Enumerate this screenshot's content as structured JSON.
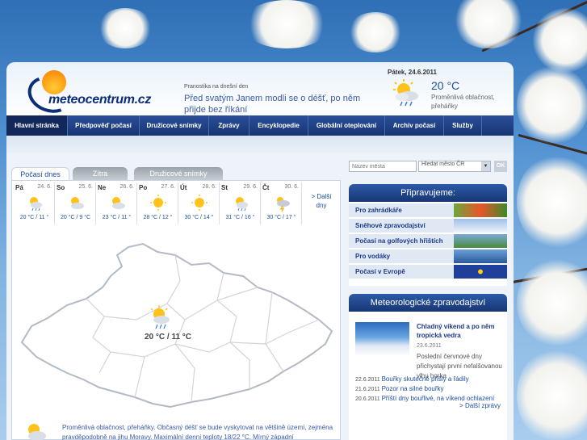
{
  "site": {
    "logo_text": "meteocentrum.cz",
    "forecast_label": "Pranostika na dnešní den",
    "forecast_text": "Před svatým Janem modli se o déšť, po něm přijde bez říkání",
    "today": {
      "date": "Pátek, 24.6.2011",
      "temp": "20 °C",
      "desc": "Proměnlivá oblačnost, přeháňky",
      "icon": "sun-cloud-rain-icon"
    }
  },
  "nav": {
    "items": [
      {
        "label": "Hlavní stránka",
        "active": true
      },
      {
        "label": "Předpověď počasí"
      },
      {
        "label": "Družicové snímky"
      },
      {
        "label": "Zprávy"
      },
      {
        "label": "Encyklopedie"
      },
      {
        "label": "Globální oteplování"
      },
      {
        "label": "Archiv počasí"
      },
      {
        "label": "Služby"
      }
    ]
  },
  "tabs": {
    "today": "Počasí dnes",
    "tomorrow": "Zítra",
    "satellite": "Družicové snímky"
  },
  "days": [
    {
      "name": "Pá",
      "date": "24. 6.",
      "temp": "20 °C / 11 °",
      "icon": "sun-cloud-rain-icon"
    },
    {
      "name": "So",
      "date": "25. 6.",
      "temp": "20 °C / 9 °C",
      "icon": "sun-cloud-icon"
    },
    {
      "name": "Ne",
      "date": "26. 6.",
      "temp": "23 °C / 11 °",
      "icon": "sun-cloud-icon"
    },
    {
      "name": "Po",
      "date": "27. 6.",
      "temp": "28 °C / 12 °",
      "icon": "sun-icon"
    },
    {
      "name": "Út",
      "date": "28. 6.",
      "temp": "30 °C / 14 °",
      "icon": "sun-icon"
    },
    {
      "name": "St",
      "date": "29. 6.",
      "temp": "31 °C / 16 °",
      "icon": "sun-cloud-rain-icon"
    },
    {
      "name": "Čt",
      "date": "30. 6.",
      "temp": "30 °C / 17 °",
      "icon": "storm-icon"
    }
  ],
  "more_days": "> Další dny",
  "map": {
    "temp": "20 °C / 11 °C",
    "icon": "sun-cloud-rain-icon"
  },
  "bottom_text": "Proměnlivá oblačnost, přeháňky. Občasný déšť se bude vyskytovat na většině území, zejména pravděpodobně na jihu Moravy. Maximální denní teploty 18/22 °C. Mírný západní",
  "search": {
    "placeholder": "Název města",
    "select_value": "Hledat město ČR",
    "ok": "OK"
  },
  "pripravujeme": {
    "title": "Připravujeme:",
    "items": [
      {
        "label": "Pro zahrádkáře",
        "color": "#5a9e3a"
      },
      {
        "label": "Sněhové zpravodajství",
        "color": "#c8d8ec"
      },
      {
        "label": "Počasí na golfových hřištích",
        "color": "#4a8a3a"
      },
      {
        "label": "Pro vodáky",
        "color": "#4a7fc0"
      },
      {
        "label": "Počasí v Evropě",
        "color": "#1f3f9a"
      }
    ]
  },
  "news": {
    "title": "Meteorologické zpravodajství",
    "featured": {
      "title": "Chladný víkend a po něm tropická vedra",
      "date": "23.6.2011",
      "desc": "Poslední červnové dny přichystají první nefalšovanou vlhu horka"
    },
    "items": [
      {
        "date": "22.6.2011",
        "title": "Bouřky skutečně přišly a řádily"
      },
      {
        "date": "21.6.2011",
        "title": "Pozor na silné bouřky"
      },
      {
        "date": "20.6.2011",
        "title": "Příští dny bouřlivé, na víkend ochlazení"
      }
    ],
    "more": "> Další zprávy"
  }
}
